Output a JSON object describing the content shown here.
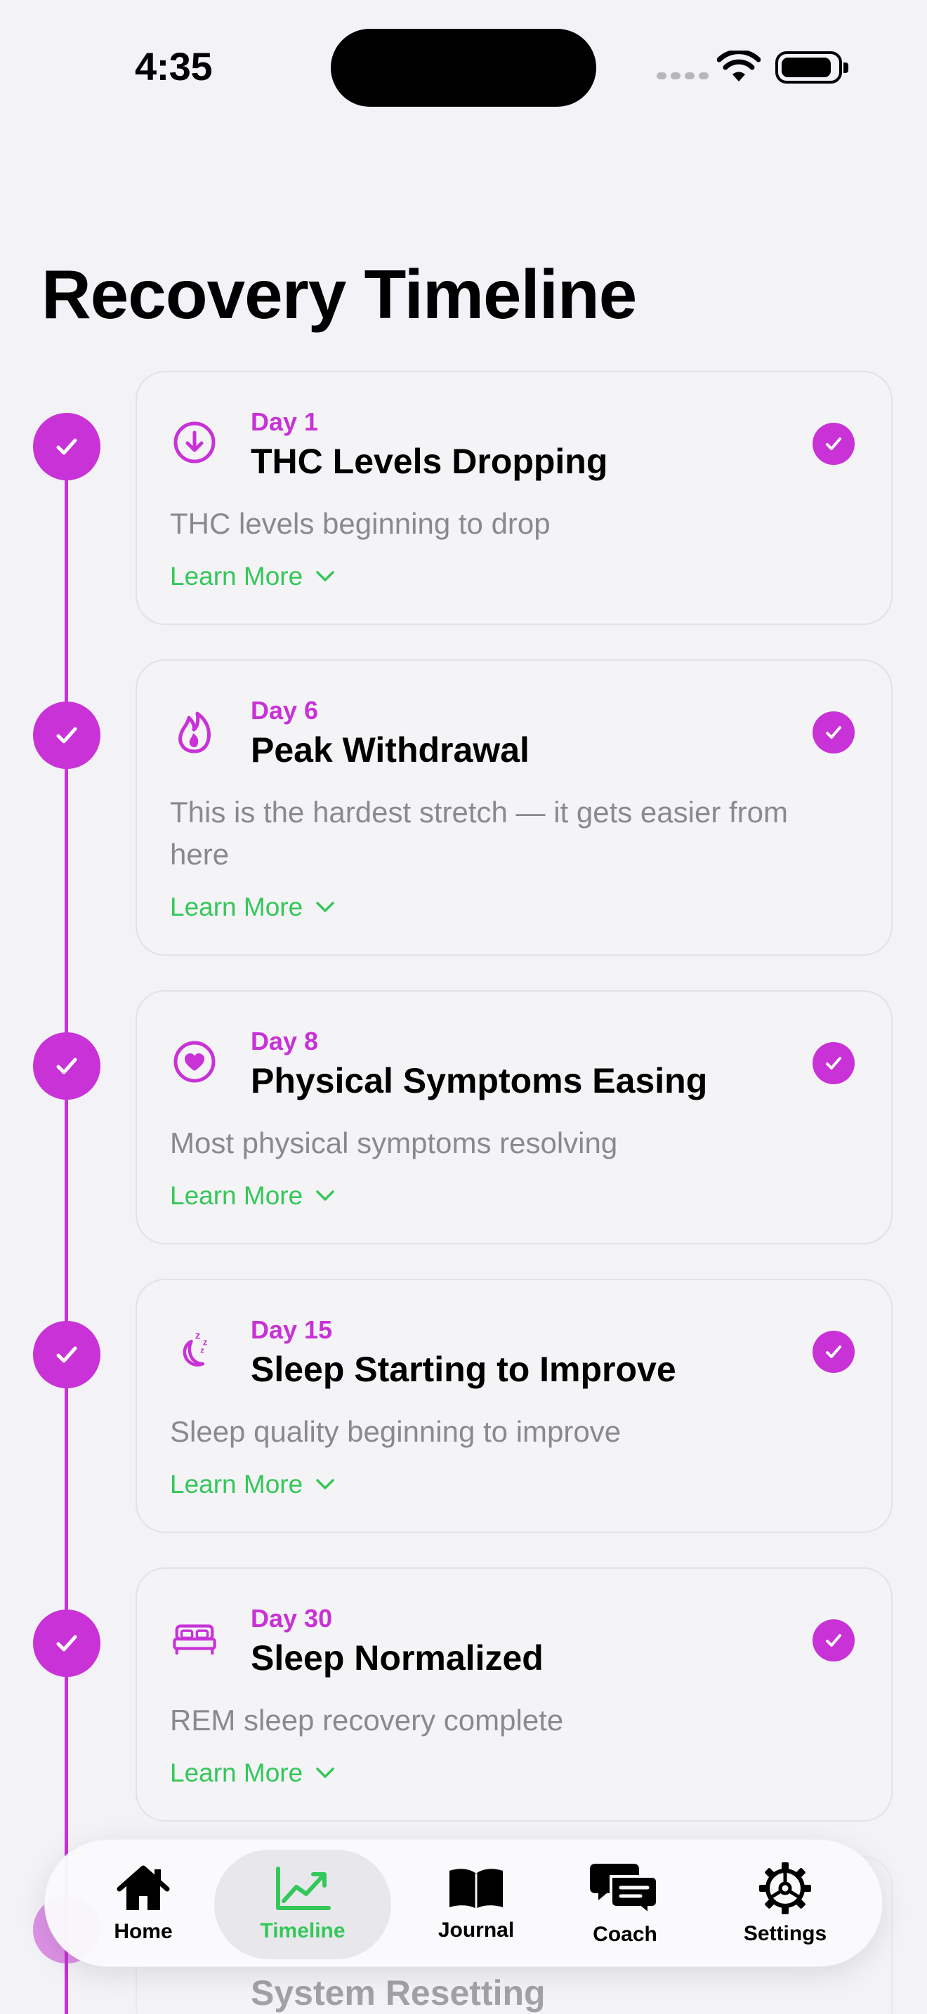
{
  "status": {
    "time": "4:35"
  },
  "page_title": "Recovery Timeline",
  "colors": {
    "accent": "#c832d6",
    "link": "#34c759",
    "muted_text": "#8a8a8e"
  },
  "milestones": [
    {
      "day": "Day 1",
      "title": "THC Levels Dropping",
      "description": "THC levels beginning to drop",
      "link": "Learn More",
      "icon": "arrow-down-circle-icon",
      "completed": true
    },
    {
      "day": "Day 6",
      "title": "Peak Withdrawal",
      "description": "This is the hardest stretch — it gets easier from here",
      "link": "Learn More",
      "icon": "flame-icon",
      "completed": true
    },
    {
      "day": "Day 8",
      "title": "Physical Symptoms Easing",
      "description": "Most physical symptoms resolving",
      "link": "Learn More",
      "icon": "heart-circle-icon",
      "completed": true
    },
    {
      "day": "Day 15",
      "title": "Sleep Starting to Improve",
      "description": "Sleep quality beginning to improve",
      "link": "Learn More",
      "icon": "moon-zzz-icon",
      "completed": true
    },
    {
      "day": "Day 30",
      "title": "Sleep Normalized",
      "description": "REM sleep recovery complete",
      "link": "Learn More",
      "icon": "bed-icon",
      "completed": true
    },
    {
      "day": "",
      "title": "System Resetting",
      "description": "",
      "link": "",
      "icon": "",
      "completed": true
    }
  ],
  "tabs": [
    {
      "label": "Home",
      "icon": "house-icon",
      "active": false
    },
    {
      "label": "Timeline",
      "icon": "chart-line-uptrend-icon",
      "active": true
    },
    {
      "label": "Journal",
      "icon": "book-icon",
      "active": false
    },
    {
      "label": "Coach",
      "icon": "chat-bubbles-icon",
      "active": false
    },
    {
      "label": "Settings",
      "icon": "gear-icon",
      "active": false
    }
  ]
}
